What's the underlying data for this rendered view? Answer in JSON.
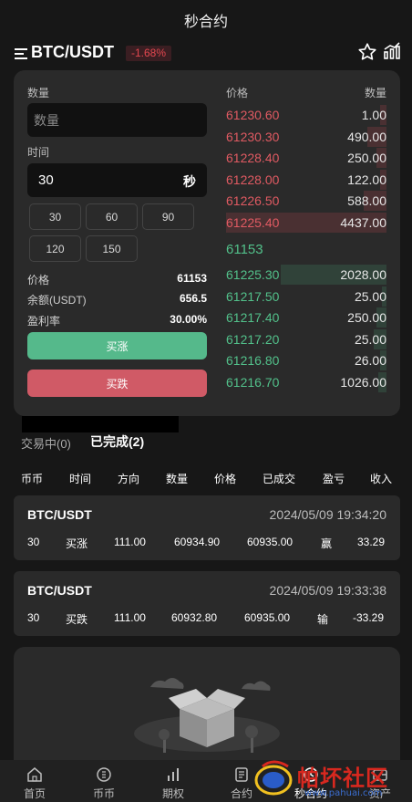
{
  "page": {
    "title": "秒合约"
  },
  "header": {
    "symbol": "BTC/USDT",
    "change": "-1.68%"
  },
  "order_form": {
    "qty_label": "数量",
    "qty_placeholder": "数量",
    "time_label": "时间",
    "time_value": "30",
    "time_unit": "秒",
    "time_options": [
      "30",
      "60",
      "90",
      "120",
      "150"
    ],
    "info": [
      {
        "label": "价格",
        "value": "61153"
      },
      {
        "label": "余额(USDT)",
        "value": "656.5"
      },
      {
        "label": "盈利率",
        "value": "30.00%"
      }
    ],
    "buy_up_label": "买涨",
    "buy_down_label": "买跌"
  },
  "orderbook": {
    "price_header": "价格",
    "qty_header": "数量",
    "asks": [
      {
        "price": "61230.60",
        "qty": "1.00",
        "depth": 0.04
      },
      {
        "price": "61230.30",
        "qty": "490.00",
        "depth": 0.12
      },
      {
        "price": "61228.40",
        "qty": "250.00",
        "depth": 0.06
      },
      {
        "price": "61228.00",
        "qty": "122.00",
        "depth": 0.04
      },
      {
        "price": "61226.50",
        "qty": "588.00",
        "depth": 0.14
      },
      {
        "price": "61225.40",
        "qty": "4437.00",
        "depth": 1.0
      }
    ],
    "last_price": "61153",
    "bids": [
      {
        "price": "61225.30",
        "qty": "2028.00",
        "depth": 0.66
      },
      {
        "price": "61217.50",
        "qty": "25.00",
        "depth": 0.03
      },
      {
        "price": "61217.40",
        "qty": "250.00",
        "depth": 0.06
      },
      {
        "price": "61217.20",
        "qty": "25.00",
        "depth": 0.08
      },
      {
        "price": "61216.80",
        "qty": "26.00",
        "depth": 0.04
      },
      {
        "price": "61216.70",
        "qty": "1026.00",
        "depth": 0.05
      }
    ]
  },
  "orders": {
    "tab_active_trading": "交易中(0)",
    "tab_completed": "已完成(2)",
    "columns": [
      "币币",
      "时间",
      "方向",
      "数量",
      "价格",
      "已成交",
      "盈亏",
      "收入"
    ],
    "rows": [
      {
        "symbol": "BTC/USDT",
        "time": "2024/05/09 19:34:20",
        "period": "30",
        "direction": "买涨",
        "amount": "111.00",
        "open_price": "60934.90",
        "close_price": "60935.00",
        "result": "赢",
        "pnl": "33.29"
      },
      {
        "symbol": "BTC/USDT",
        "time": "2024/05/09 19:33:38",
        "period": "30",
        "direction": "买跌",
        "amount": "111.00",
        "open_price": "60932.80",
        "close_price": "60935.00",
        "result": "输",
        "pnl": "-33.29"
      }
    ]
  },
  "nav": {
    "items": [
      {
        "label": "首页",
        "icon": "home-icon"
      },
      {
        "label": "币币",
        "icon": "coin-icon"
      },
      {
        "label": "期权",
        "icon": "bars-icon"
      },
      {
        "label": "合约",
        "icon": "doc-icon"
      },
      {
        "label": "秒合约",
        "icon": "clock-icon"
      },
      {
        "label": "资产",
        "icon": "wallet-icon"
      }
    ]
  },
  "watermark": {
    "text": "帕坏社区",
    "url": "www.pahuai.com"
  }
}
